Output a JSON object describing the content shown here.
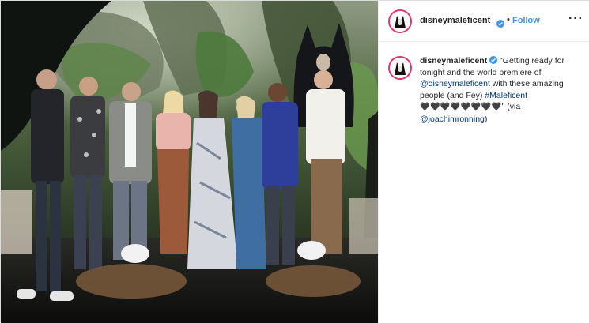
{
  "post": {
    "username": "disneymaleficent",
    "verified": true,
    "header_separator": "•",
    "follow_label": "Follow",
    "more_label": "···"
  },
  "caption": {
    "username": "disneymaleficent",
    "text_part1": "\"Getting ready for tonight and the world premiere of ",
    "mention1": "@disneymaleficent",
    "text_part2": " with these amazing people (and Fey) ",
    "hashtag": "#Maleficent",
    "hearts": "🖤🖤🖤🖤🖤🖤🖤🖤",
    "text_part3": "\" (via ",
    "mention2": "@joachimronning",
    "text_part4": ")"
  },
  "colors": {
    "follow_blue": "#3897f0",
    "link_navy": "#003569",
    "verified_blue": "#3897f0",
    "story_ring": "#e2366b"
  },
  "icons": {
    "verified": "verified-badge-icon",
    "more": "more-options-icon"
  }
}
